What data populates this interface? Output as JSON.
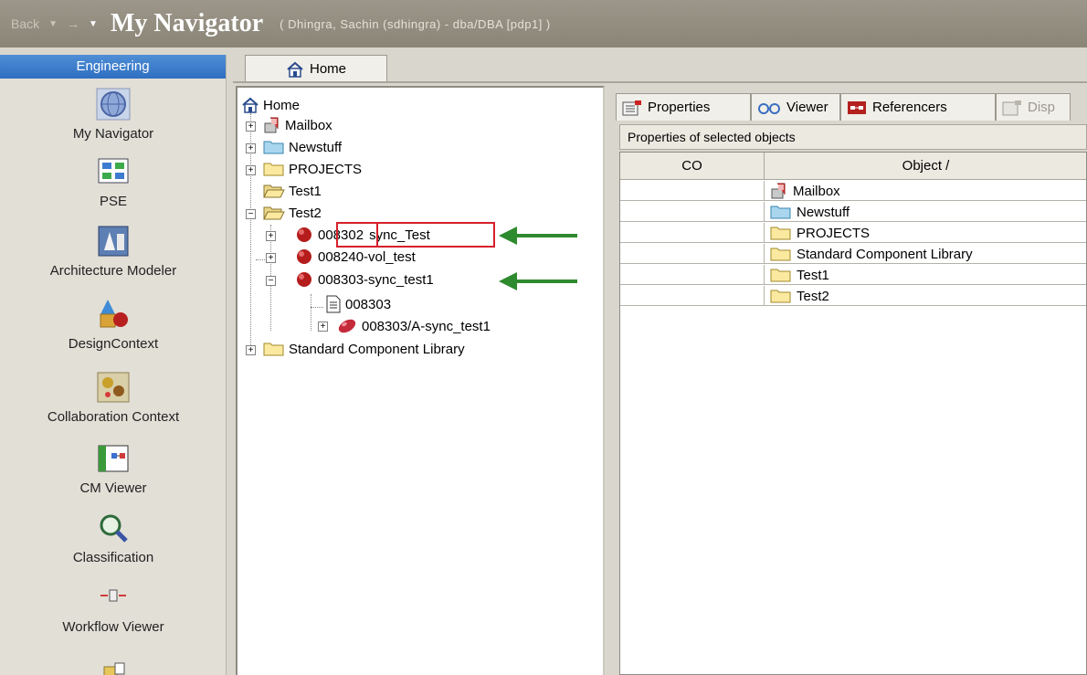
{
  "titlebar": {
    "back_label": "Back",
    "title": "My Navigator",
    "user_info": "( Dhingra, Sachin (sdhingra) - dba/DBA  [pdp1] )"
  },
  "sidebar": {
    "header": "Engineering",
    "items": [
      {
        "label": "My Navigator",
        "icon": "globe-icon"
      },
      {
        "label": "PSE",
        "icon": "structure-icon"
      },
      {
        "label": "Architecture Modeler",
        "icon": "architecture-icon"
      },
      {
        "label": "DesignContext",
        "icon": "shapes-icon"
      },
      {
        "label": "Collaboration Context",
        "icon": "collaboration-icon"
      },
      {
        "label": "CM Viewer",
        "icon": "cm-viewer-icon"
      },
      {
        "label": "Classification",
        "icon": "magnifier-icon"
      },
      {
        "label": "Workflow Viewer",
        "icon": "workflow-icon"
      }
    ]
  },
  "home_tab": {
    "label": "Home"
  },
  "tree": {
    "root": "Home",
    "nodes": [
      {
        "label": "Mailbox",
        "icon": "mailbox-icon"
      },
      {
        "label": "Newstuff",
        "icon": "folder-blue-icon"
      },
      {
        "label": "PROJECTS",
        "icon": "folder-icon"
      },
      {
        "label": "Test1",
        "icon": "folder-open-icon"
      },
      {
        "label": "Test2",
        "icon": "folder-open-icon"
      },
      {
        "label_id": "008302",
        "label_rest": "sync_Test",
        "icon": "item-red-icon"
      },
      {
        "label": "008240-vol_test",
        "icon": "item-red-icon"
      },
      {
        "label": "008303-sync_test1",
        "icon": "item-red-icon"
      },
      {
        "label": "008303",
        "icon": "document-icon"
      },
      {
        "label": "008303/A-sync_test1",
        "icon": "revision-icon"
      },
      {
        "label": "Standard Component Library",
        "icon": "folder-icon"
      }
    ]
  },
  "right_panel": {
    "tabs": [
      {
        "label": "Properties",
        "icon": "properties-icon"
      },
      {
        "label": "Viewer",
        "icon": "viewer-icon"
      },
      {
        "label": "Referencers",
        "icon": "referencers-icon"
      },
      {
        "label": "Disp",
        "icon": "display-icon"
      }
    ],
    "properties_label": "Properties of selected objects",
    "columns": [
      "CO",
      "Object /"
    ],
    "rows": [
      {
        "object": "Mailbox",
        "icon": "mailbox-icon"
      },
      {
        "object": "Newstuff",
        "icon": "folder-blue-icon"
      },
      {
        "object": "PROJECTS",
        "icon": "folder-icon"
      },
      {
        "object": "Standard Component Library",
        "icon": "folder-icon"
      },
      {
        "object": "Test1",
        "icon": "folder-icon"
      },
      {
        "object": "Test2",
        "icon": "folder-icon"
      }
    ]
  },
  "colors": {
    "titlebar": "#8e897b",
    "engineering_header": "#3b7ecb",
    "annotation_red": "#d6202a",
    "annotation_arrow": "#2e8a2e"
  }
}
